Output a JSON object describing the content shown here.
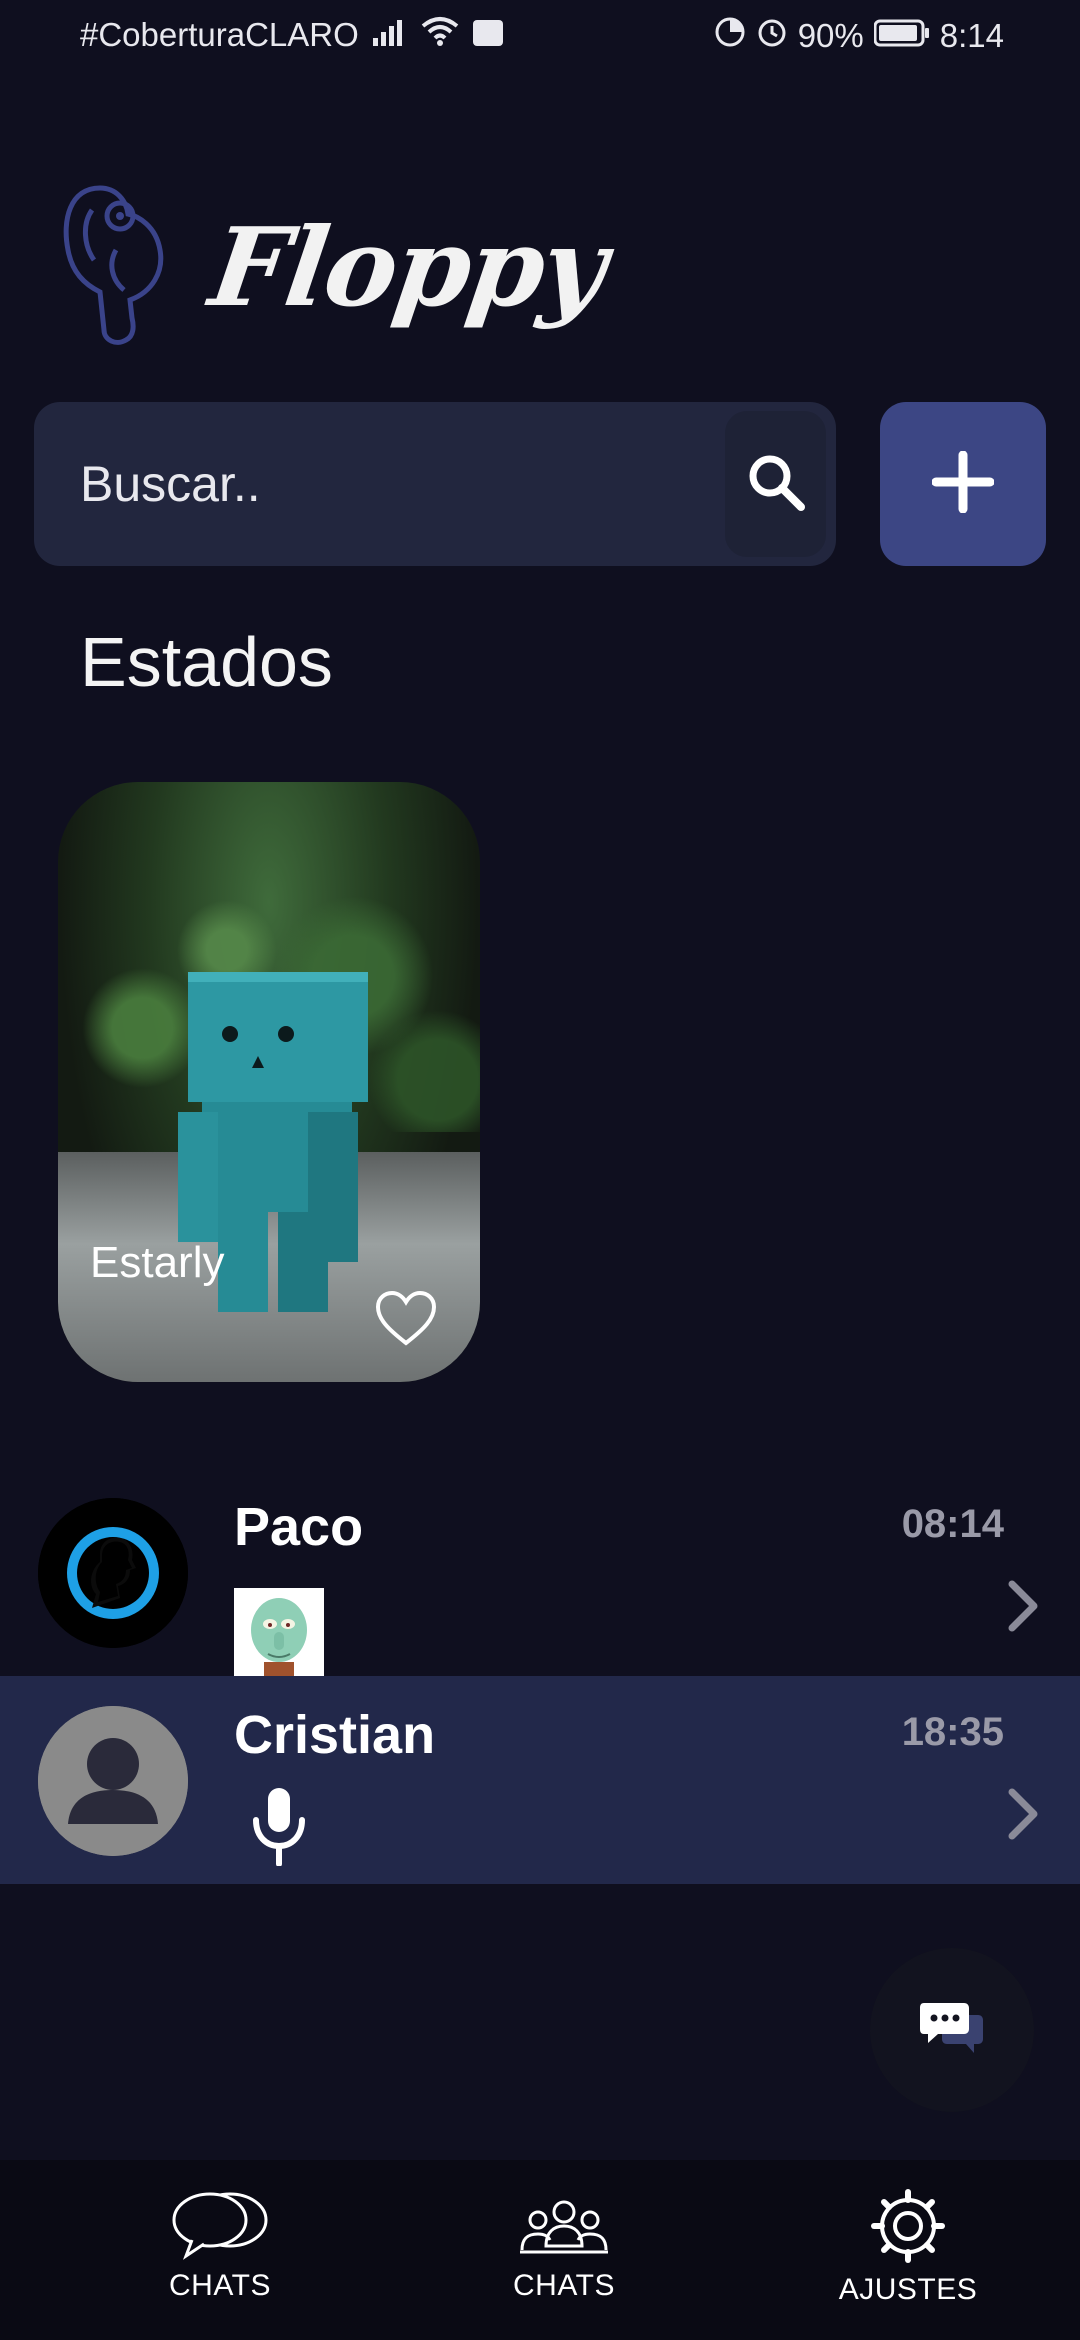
{
  "status_bar": {
    "carrier": "#CoberturaCLARO",
    "battery": "90%",
    "time": "8:14"
  },
  "brand": {
    "name": "Floppy"
  },
  "search": {
    "placeholder": "Buscar.."
  },
  "stories": {
    "title": "Estados",
    "items": [
      {
        "name": "Estarly"
      }
    ]
  },
  "chats": [
    {
      "name": "Paco",
      "time": "08:14",
      "preview_type": "sticker"
    },
    {
      "name": "Cristian",
      "time": "18:35",
      "preview_type": "voice"
    }
  ],
  "nav": {
    "items": [
      {
        "label": "CHATS",
        "icon": "chat-bubbles-icon"
      },
      {
        "label": "CHATS",
        "icon": "group-icon"
      },
      {
        "label": "AJUSTES",
        "icon": "gear-icon"
      }
    ]
  },
  "colors": {
    "background": "#0f0f1f",
    "surface": "#22263e",
    "accent": "#3c4684",
    "active_row": "#22284a"
  }
}
